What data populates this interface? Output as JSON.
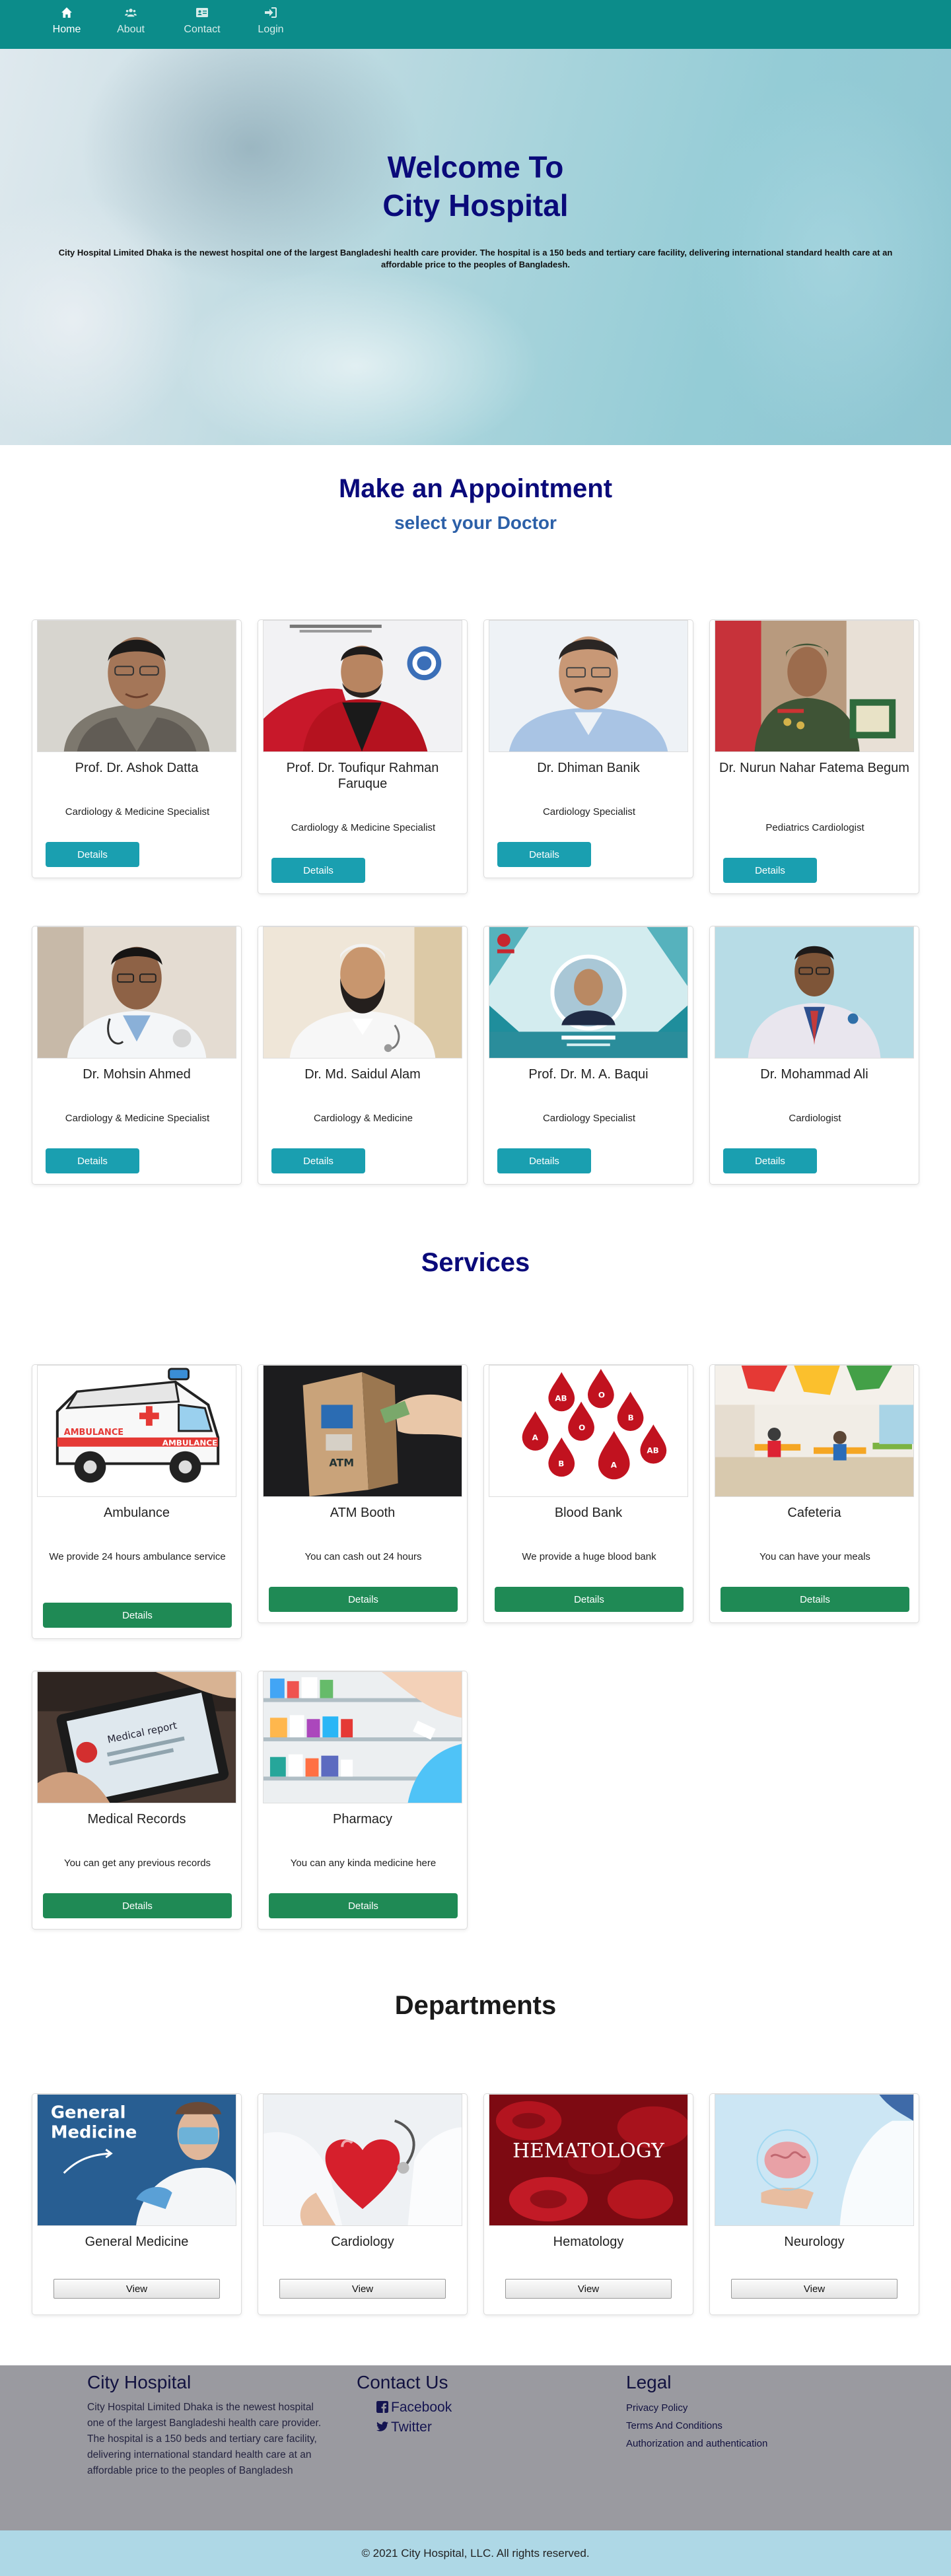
{
  "nav": {
    "items": [
      {
        "label": "Home",
        "icon": "home-icon"
      },
      {
        "label": "About",
        "icon": "users-icon"
      },
      {
        "label": "Contact",
        "icon": "contact-card-icon"
      },
      {
        "label": "Login",
        "icon": "sign-in-icon"
      }
    ]
  },
  "hero": {
    "title_line1": "Welcome To",
    "title_line2": "City Hospital",
    "description": "City Hospital Limited Dhaka is the newest hospital one of the largest Bangladeshi health care provider. The hospital is a 150 beds and tertiary care facility, delivering international standard health care at an affordable price to the peoples of Bangladesh."
  },
  "appointment": {
    "title": "Make an Appointment",
    "subtitle": "select your Doctor",
    "button_label": "Details",
    "doctors": [
      {
        "name": "Prof. Dr. Ashok Datta",
        "specialty": "Cardiology & Medicine Specialist"
      },
      {
        "name": "Prof. Dr. Toufiqur Rahman Faruque",
        "specialty": "Cardiology & Medicine Specialist"
      },
      {
        "name": "Dr. Dhiman Banik",
        "specialty": "Cardiology Specialist"
      },
      {
        "name": "Dr. Nurun Nahar Fatema Begum",
        "specialty": "Pediatrics Cardiologist"
      },
      {
        "name": "Dr. Mohsin Ahmed",
        "specialty": "Cardiology & Medicine Specialist"
      },
      {
        "name": "Dr. Md. Saidul Alam",
        "specialty": "Cardiology & Medicine"
      },
      {
        "name": "Prof. Dr. M. A. Baqui",
        "specialty": "Cardiology Specialist"
      },
      {
        "name": "Dr. Mohammad Ali",
        "specialty": "Cardiologist"
      }
    ]
  },
  "services": {
    "title": "Services",
    "button_label": "Details",
    "items": [
      {
        "name": "Ambulance",
        "description": "We provide 24 hours ambulance service",
        "ambulance_text": "AMBULANCE"
      },
      {
        "name": "ATM Booth",
        "description": "You can cash out 24 hours",
        "atm_text": "ATM"
      },
      {
        "name": "Blood Bank",
        "description": "We provide a huge blood bank",
        "blood_types": [
          "AB",
          "O",
          "B",
          "A",
          "O",
          "B",
          "AB",
          "A",
          "B"
        ]
      },
      {
        "name": "Cafeteria",
        "description": "You can have your meals"
      },
      {
        "name": "Medical Records",
        "description": "You can get any previous records",
        "records_text": "Medical report"
      },
      {
        "name": "Pharmacy",
        "description": "You can any kinda medicine here"
      }
    ]
  },
  "departments": {
    "title": "Departments",
    "button_label": "View",
    "items": [
      {
        "name": "General Medicine",
        "image_text_line1": "General",
        "image_text_line2": "Medicine"
      },
      {
        "name": "Cardiology"
      },
      {
        "name": "Hematology",
        "image_text": "HEMATOLOGY"
      },
      {
        "name": "Neurology"
      }
    ]
  },
  "footer": {
    "brand_title": "City Hospital",
    "brand_text": "City Hospital Limited Dhaka is the newest hospital one of the largest Bangladeshi health care provider. The hospital is a 150 beds and tertiary care facility, delivering international standard health care at an affordable price to the peoples of Bangladesh",
    "contact_title": "Contact Us",
    "facebook": "Facebook",
    "twitter": "Twitter",
    "legal_title": "Legal",
    "legal_links": [
      "Privacy Policy",
      "Terms And Conditions",
      "Authorization and authentication"
    ],
    "copyright": "© 2021 City Hospital, LLC. All rights reserved."
  },
  "colors": {
    "navbar": "#0c8c8a",
    "heading_navy": "#0a0a7a",
    "details_teal": "#1a9fb0",
    "details_green": "#1f8a55",
    "footer_gray": "#9a9aa0",
    "copyright_bar": "#aed8e6"
  }
}
